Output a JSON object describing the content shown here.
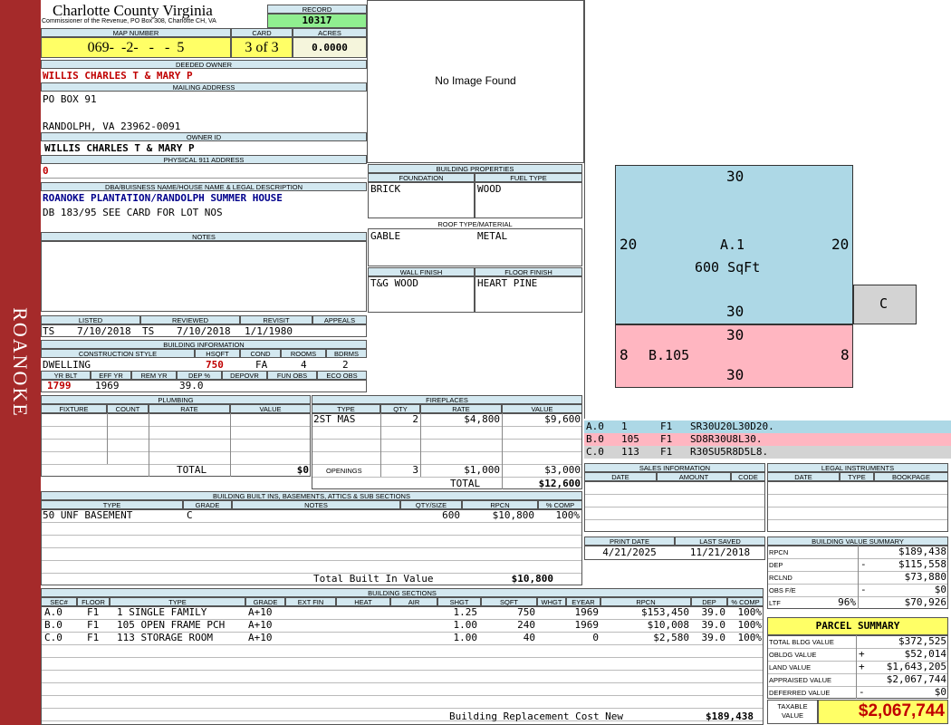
{
  "sidebar": {
    "label": "ROANOKE"
  },
  "header": {
    "title": "Charlotte County Virginia",
    "subtitle": "Commissioner of the Revenue, PO Box 308, Charlotte CH, VA"
  },
  "record": {
    "label": "RECORD",
    "value": "10317"
  },
  "map": {
    "label": "MAP NUMBER",
    "value": "069-  -2-   -   -  5"
  },
  "card": {
    "label": "CARD",
    "value": "3 of 3"
  },
  "acres": {
    "label": "ACRES",
    "value": "0.0000"
  },
  "owner": {
    "label": "DEEDED OWNER",
    "value": "WILLIS CHARLES T & MARY P"
  },
  "mailing": {
    "label": "MAILING ADDRESS",
    "line1": "PO BOX 91",
    "line2": "RANDOLPH, VA 23962-0091"
  },
  "owner_id": {
    "label": "OWNER ID",
    "value": "WILLIS CHARLES T & MARY P"
  },
  "physical": {
    "label": "PHYSICAL 911 ADDRESS",
    "value": "0"
  },
  "dba": {
    "label": "DBA/BUISNESS NAME/HOUSE NAME & LEGAL DESCRIPTION",
    "line1": "ROANOKE PLANTATION/RANDOLPH SUMMER HOUSE",
    "line2": "DB 183/95 SEE CARD FOR LOT NOS"
  },
  "notes": {
    "label": "NOTES"
  },
  "listed": {
    "label": "LISTED",
    "by": "TS",
    "date": "7/10/2018"
  },
  "reviewed": {
    "label": "REVIEWED",
    "by": "TS",
    "date": "7/10/2018"
  },
  "revisit": {
    "label": "REVISIT",
    "date": "1/1/1980"
  },
  "appeals": {
    "label": "APPEALS"
  },
  "building_info": {
    "label": "BUILDING INFORMATION",
    "headers": [
      "CONSTRUCTION STYLE",
      "HSQFT",
      "COND",
      "ROOMS",
      "BDRMS"
    ],
    "style": "DWELLING",
    "hsqft": "750",
    "cond": "FA",
    "rooms": "4",
    "bdrms": "2",
    "headers2": [
      "YR BLT",
      "EFF YR",
      "REM YR",
      "DEP %",
      "DEPOVR",
      "FUN OBS",
      "ECO OBS"
    ],
    "yr_blt": "1799",
    "eff_yr": "1969",
    "rem_yr": "",
    "dep": "39.0"
  },
  "image": {
    "text": "No Image Found"
  },
  "building_props": {
    "label": "BUILDING PROPERTIES",
    "foundation_label": "FOUNDATION",
    "foundation": "BRICK",
    "fuel_label": "FUEL TYPE",
    "fuel": "WOOD",
    "roof_label": "ROOF TYPE/MATERIAL",
    "roof_type": "GABLE",
    "roof_material": "METAL",
    "wall_label": "WALL FINISH",
    "wall": "T&G WOOD",
    "floor_label": "FLOOR FINISH",
    "floor": "HEART PINE"
  },
  "sketch": {
    "a_top": "30",
    "a_left": "20",
    "a_right": "20",
    "a_bottom": "30",
    "a_name": "A.1",
    "a_area": "600 SqFt",
    "b_top": "30",
    "b_left": "8",
    "b_right": "8",
    "b_bottom": "30",
    "b_name": "B.105",
    "c_name": "C"
  },
  "sketch_codes": [
    {
      "sec": "A.0",
      "code": "1",
      "floor": "F1",
      "desc": "SR30U20L30D20."
    },
    {
      "sec": "B.0",
      "code": "105",
      "floor": "F1",
      "desc": "SD8R30U8L30."
    },
    {
      "sec": "C.0",
      "code": "113",
      "floor": "F1",
      "desc": "R30SU5R8D5L8."
    }
  ],
  "plumbing": {
    "label": "PLUMBING",
    "headers": [
      "FIXTURE",
      "COUNT",
      "RATE",
      "VALUE"
    ],
    "total_label": "TOTAL",
    "total": "$0"
  },
  "fireplaces": {
    "label": "FIREPLACES",
    "headers": [
      "TYPE",
      "QTY",
      "RATE",
      "VALUE"
    ],
    "row": {
      "type": "2ST MAS",
      "qty": "2",
      "rate": "$4,800",
      "value": "$9,600"
    },
    "openings": {
      "label": "OPENINGS",
      "qty": "3",
      "rate": "$1,000",
      "value": "$3,000"
    },
    "total_label": "TOTAL",
    "total": "$12,600"
  },
  "sales": {
    "label": "SALES INFORMATION",
    "headers": [
      "DATE",
      "AMOUNT",
      "CODE"
    ]
  },
  "legal": {
    "label": "LEGAL INSTRUMENTS",
    "headers": [
      "DATE",
      "TYPE",
      "BOOKPAGE"
    ]
  },
  "built_ins": {
    "label": "BUILDING BUILT INS, BASEMENTS, ATTICS & SUB SECTIONS",
    "headers": [
      "TYPE",
      "GRADE",
      "NOTES",
      "QTY/SIZE",
      "RPCN",
      "% COMP"
    ],
    "row": {
      "type": "50 UNF BASEMENT",
      "grade": "C",
      "notes": "",
      "qty": "600",
      "rpcn": "$10,800",
      "comp": "100%"
    },
    "total_label": "Total Built In Value",
    "total": "$10,800"
  },
  "print": {
    "label": "PRINT DATE",
    "value": "4/21/2025"
  },
  "saved": {
    "label": "LAST SAVED",
    "value": "11/21/2018"
  },
  "value_summary": {
    "label": "BUILDING VALUE SUMMARY",
    "rows": [
      {
        "label": "RPCN",
        "sign": "",
        "value": "$189,438"
      },
      {
        "label": "DEP",
        "sign": "-",
        "value": "$115,558"
      },
      {
        "label": "RCLND",
        "sign": "",
        "value": "$73,880"
      },
      {
        "label": "OBS F/E",
        "sign": "-",
        "value": "$0"
      },
      {
        "label": "LTF",
        "pct": "96%",
        "sign": "",
        "value": "$70,926"
      }
    ]
  },
  "sections": {
    "label": "BUILDING SECTIONS",
    "headers": [
      "SEC#",
      "FLOOR",
      "TYPE",
      "GRADE",
      "EXT FIN",
      "HEAT",
      "AIR",
      "SHGT",
      "SQFT",
      "WHGT",
      "EYEAR",
      "RPCN",
      "DEP",
      "% COMP"
    ],
    "rows": [
      {
        "sec": "A.0",
        "floor": "F1",
        "type": "1 SINGLE FAMILY",
        "grade": "A+10",
        "shgt": "1.25",
        "sqft": "750",
        "eyear": "1969",
        "rpcn": "$153,450",
        "dep": "39.0",
        "comp": "100%"
      },
      {
        "sec": "B.0",
        "floor": "F1",
        "type": "105 OPEN FRAME PCH",
        "grade": "A+10",
        "shgt": "1.00",
        "sqft": "240",
        "eyear": "1969",
        "rpcn": "$10,008",
        "dep": "39.0",
        "comp": "100%"
      },
      {
        "sec": "C.0",
        "floor": "F1",
        "type": "113 STORAGE ROOM",
        "grade": "A+10",
        "shgt": "1.00",
        "sqft": "40",
        "eyear": "0",
        "rpcn": "$2,580",
        "dep": "39.0",
        "comp": "100%"
      }
    ],
    "total_label": "Building Replacement Cost New",
    "total": "$189,438"
  },
  "parcel": {
    "label": "PARCEL SUMMARY",
    "rows": [
      {
        "label": "TOTAL BLDG VALUE",
        "sign": "",
        "value": "$372,525"
      },
      {
        "label": "OBLDG VALUE",
        "sign": "+",
        "value": "$52,014"
      },
      {
        "label": "LAND VALUE",
        "sign": "+",
        "value": "$1,643,205"
      },
      {
        "label": "APPRAISED VALUE",
        "sign": "",
        "value": "$2,067,744"
      },
      {
        "label": "DEFERRED VALUE",
        "sign": "-",
        "value": "$0"
      }
    ],
    "taxable_label": "TAXABLE VALUE",
    "taxable": "$2,067,744"
  }
}
